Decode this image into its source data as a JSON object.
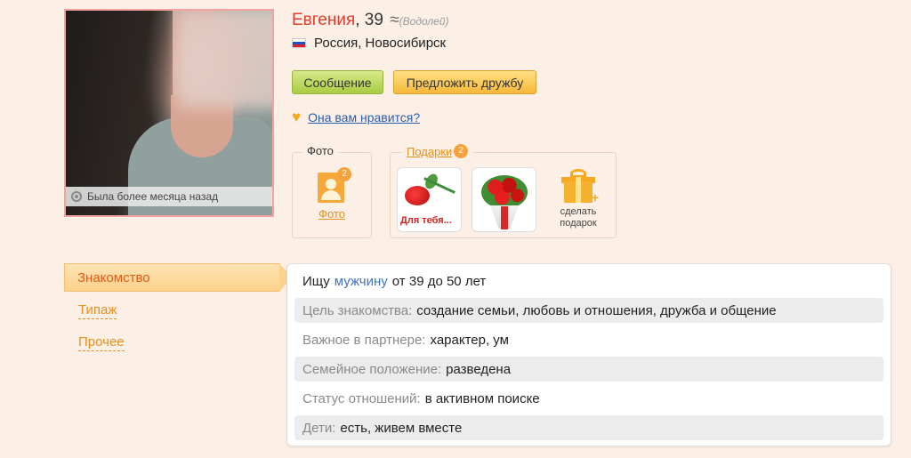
{
  "profile": {
    "name": "Евгения",
    "age": ", 39",
    "zodiac_symbol": "≈",
    "zodiac": "(Водолей)",
    "location": "Россия, Новосибирск",
    "status": "Была более месяца назад"
  },
  "actions": {
    "message_label": "Сообщение",
    "friend_label": "Предложить дружбу",
    "like_question": "Она вам нравится?"
  },
  "photo_box": {
    "title": "Фото",
    "count": "2",
    "link_label": "Фото"
  },
  "gifts_box": {
    "title": "Подарки",
    "count": "2",
    "gift1_text": "Для тебя...",
    "make_gift_label_line1": "сделать",
    "make_gift_label_line2": "подарок"
  },
  "nav": {
    "active": "Знакомство",
    "item2": "Типаж",
    "item3": "Прочее"
  },
  "details": {
    "seek_prefix": "Ищу",
    "seek_gender": "мужчину",
    "seek_suffix": "от 39 до 50 лет",
    "rows": [
      {
        "label": "Цель знакомства:",
        "value": "создание семьи, любовь и отношения, дружба и общение"
      },
      {
        "label": "Важное в партнере:",
        "value": "характер, ум"
      },
      {
        "label": "Семейное положение:",
        "value": "разведена"
      },
      {
        "label": "Статус отношений:",
        "value": "в активном поиске"
      },
      {
        "label": "Дети:",
        "value": "есть, живем вместе"
      }
    ]
  },
  "colors": {
    "background": "#fcefe6",
    "name": "#e43d2b",
    "link": "#2a5db0",
    "accent_orange": "#e8901c"
  }
}
